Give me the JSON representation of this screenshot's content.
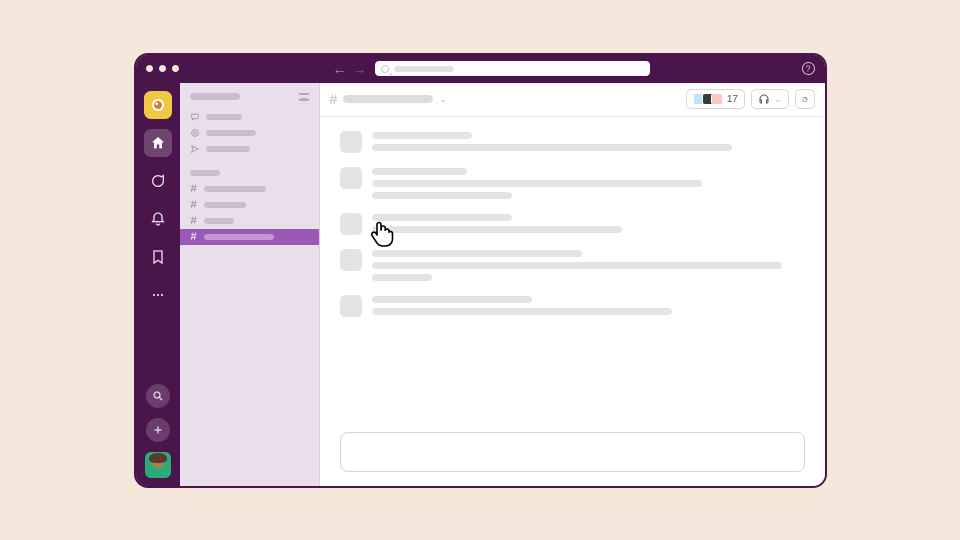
{
  "colors": {
    "brand": "#4a154b",
    "accent": "#9b59b6",
    "workspace_badge": "#f2c744",
    "page_bg": "#f3e8d9"
  },
  "titlebar": {
    "help_glyph": "?"
  },
  "rail": {
    "icons": [
      "home",
      "dm",
      "activity",
      "later",
      "more"
    ],
    "bottom": [
      "search",
      "add"
    ]
  },
  "sidebar": {
    "top_items": [
      "threads",
      "mentions",
      "drafts"
    ],
    "channels": [
      {
        "selected": false
      },
      {
        "selected": false
      },
      {
        "selected": false
      },
      {
        "selected": true
      }
    ],
    "hash": "#"
  },
  "channel_header": {
    "hash": "#",
    "member_count": "17"
  },
  "messages": [
    {
      "lines": [
        100,
        360
      ]
    },
    {
      "lines": [
        95,
        330,
        140
      ]
    },
    {
      "lines": [
        140,
        250
      ]
    },
    {
      "lines": [
        210,
        410,
        60
      ]
    },
    {
      "lines": [
        160,
        300
      ]
    }
  ]
}
